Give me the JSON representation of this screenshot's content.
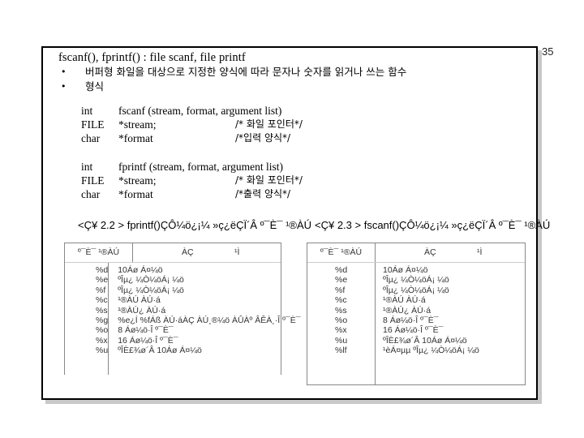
{
  "slide": {
    "page_number": "35",
    "title": "fscanf(), fprintf() : file scanf, file printf",
    "bullets": [
      "버퍼형 화일을 대상으로 지정한 양식에 따라 문자나 숫자를 읽거나 쓰는 함수",
      "형식"
    ],
    "bullet_symbol": "•"
  },
  "code_blocks": [
    {
      "rows": [
        {
          "type": "int",
          "decl": "fscanf (stream, format, argument list)",
          "comment": ""
        },
        {
          "type": "FILE",
          "decl": "*stream;",
          "comment": "/* 화일 포인터*/"
        },
        {
          "type": "char",
          "decl": "*format",
          "comment": "/*입력 양식*/"
        }
      ]
    },
    {
      "rows": [
        {
          "type": "int",
          "decl": "fprintf (stream, format, argument list)",
          "comment": ""
        },
        {
          "type": "FILE",
          "decl": "*stream;",
          "comment": "/* 화일 포인터*/"
        },
        {
          "type": "char",
          "decl": "*format",
          "comment": "/*출력 양식*/"
        }
      ]
    }
  ],
  "tables": [
    {
      "caption": "<Ç¥ 2.2 > fprintf()ÇÔ¼ö¿¡¼ »ç¿ëÇÏ´Â º¯È¯ ¹®ÀÚ",
      "header": {
        "spec": "º¯È¯ ¹®ÀÚ",
        "meaning_1": "ÀÇ",
        "meaning_2": "¹Ì"
      },
      "rows": [
        {
          "spec": "%d",
          "desc": "10Áø Á¤¼ö"
        },
        {
          "spec": "%e",
          "desc": "ºÎµ¿ ¼Ò¼öÁ¡ ¼ö"
        },
        {
          "spec": "%f",
          "desc": "ºÎµ¿ ¼Ò¼öÁ¡ ¼ö"
        },
        {
          "spec": "%c",
          "desc": "¹®ÀÚ ÀÚ·á"
        },
        {
          "spec": "%s",
          "desc": "¹®ÀÚ¿­ ÀÚ·á"
        },
        {
          "spec": "%g",
          "desc": "%e¿Í %fÁß ÀÚ·áÀÇ ÀÚ¸®¼ö ÀÛÀº ÂÊÀ¸·Î º¯È¯"
        },
        {
          "spec": "%o",
          "desc": "8 Áø¼ö·Î º¯È¯"
        },
        {
          "spec": "%x",
          "desc": "16 Áø¼ö·Î º¯È¯"
        },
        {
          "spec": "%u",
          "desc": "ºÎÈ£¾ø´Â 10Áø Á¤¼ö"
        }
      ]
    },
    {
      "caption": "<Ç¥ 2.3 > fscanf()ÇÔ¼ö¿¡¼ »ç¿ëÇÏ´Â º¯È¯ ¹®ÀÚ",
      "header": {
        "spec": "º¯È¯ ¹®ÀÚ",
        "meaning_1": "ÀÇ",
        "meaning_2": "¹Ì"
      },
      "rows": [
        {
          "spec": "%d",
          "desc": "10Áø Á¤¼ö"
        },
        {
          "spec": "%e",
          "desc": "ºÎµ¿ ¼Ò¼öÁ¡ ¼ö"
        },
        {
          "spec": "%f",
          "desc": "ºÎµ¿ ¼Ò¼öÁ¡ ¼ö"
        },
        {
          "spec": "%c",
          "desc": "¹®ÀÚ ÀÚ·á"
        },
        {
          "spec": "%s",
          "desc": "¹®ÀÚ¿­ ÀÚ·á"
        },
        {
          "spec": "%o",
          "desc": "8 Áø¼ö·Î º¯È¯"
        },
        {
          "spec": "%x",
          "desc": "16 Áø¼ö·Î º¯È¯"
        },
        {
          "spec": "%u",
          "desc": "ºÎÈ£¾ø´Â 10Áø Á¤¼ö"
        },
        {
          "spec": "%lf",
          "desc": "¹èÁ¤µµ ºÎµ¿ ¼Ò¼öÁ¡ ¼ö"
        }
      ]
    }
  ]
}
